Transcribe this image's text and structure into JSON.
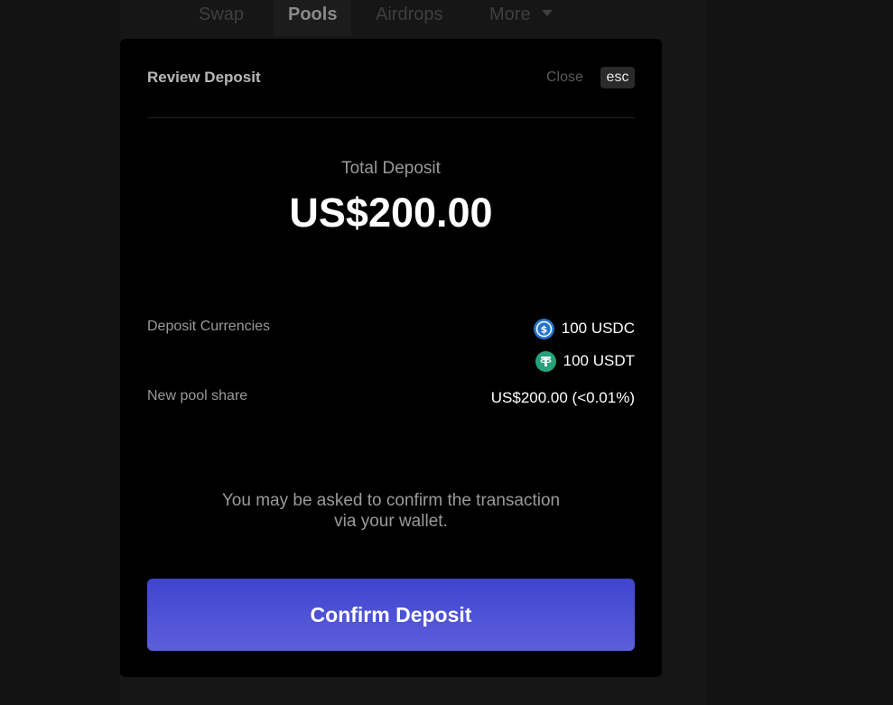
{
  "nav": {
    "items": [
      {
        "label": "Swap"
      },
      {
        "label": "Pools"
      },
      {
        "label": "Airdrops"
      },
      {
        "label": "More"
      }
    ]
  },
  "modal": {
    "title": "Review Deposit",
    "close_label": "Close",
    "esc_label": "esc",
    "total_label": "Total Deposit",
    "total_value": "US$200.00",
    "currencies_label": "Deposit Currencies",
    "currencies": [
      {
        "amount": "100 USDC",
        "icon": "usdc-icon",
        "color": "#2775ca"
      },
      {
        "amount": "100 USDT",
        "icon": "usdt-icon",
        "color": "#26a17b"
      }
    ],
    "pool_share_label": "New pool share",
    "pool_share_value": "US$200.00 (<0.01%)",
    "notice_line1": "You may be asked to confirm the transaction",
    "notice_line2": "via your wallet.",
    "confirm_label": "Confirm Deposit"
  },
  "colors": {
    "accent": "#4f52d6",
    "background": "#000000"
  }
}
